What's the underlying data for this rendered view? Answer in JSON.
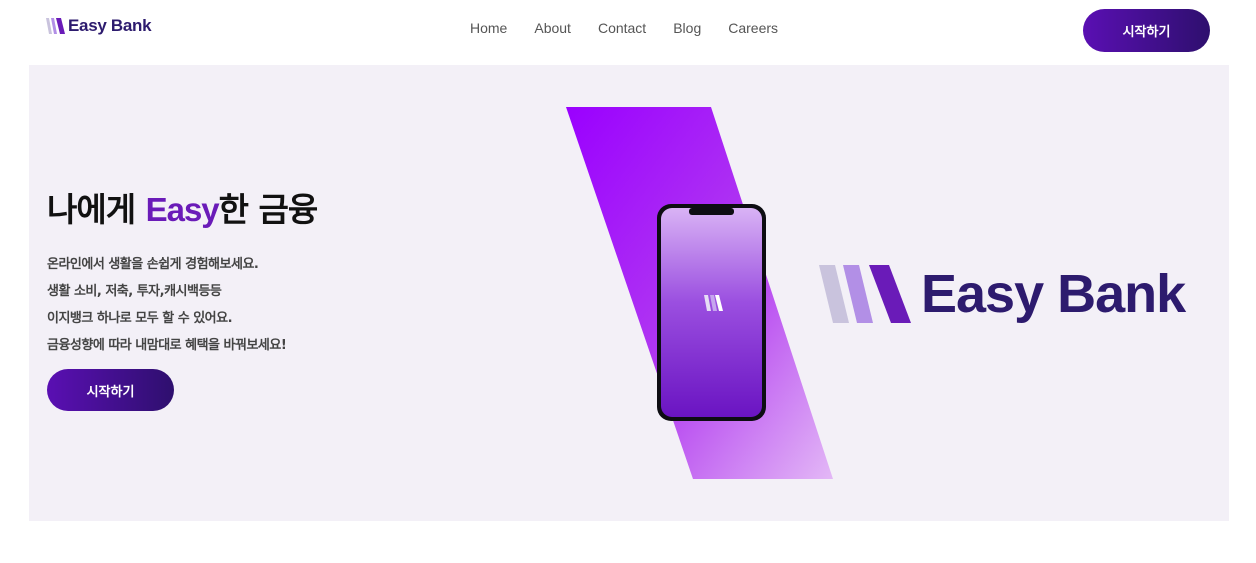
{
  "brand": {
    "name": "Easy Bank"
  },
  "nav": {
    "items": [
      {
        "label": "Home"
      },
      {
        "label": "About"
      },
      {
        "label": "Contact"
      },
      {
        "label": "Blog"
      },
      {
        "label": "Careers"
      }
    ],
    "cta_label": "시작하기"
  },
  "hero": {
    "title_prefix": "나에게 ",
    "title_accent": "Easy",
    "title_suffix": "한 금융",
    "lines": [
      "온라인에서 생활을 손쉽게 경험해보세요.",
      "생활 소비, 저축, 투자,캐시백등등",
      "이지뱅크 하나로 모두 할 수 있어요.",
      "금융성향에 따라 내맘대로 혜택을 바꿔보세요!"
    ],
    "cta_label": "시작하기",
    "brand_name": "Easy Bank"
  },
  "colors": {
    "brand_dark": "#2d1b6e",
    "accent": "#6a1bb8",
    "button_from": "#5a0fb3",
    "button_to": "#2e0f6e",
    "hero_bg": "#f3f0f7"
  },
  "icons": {
    "logo": "easy-bank-stripes-icon",
    "phone": "smartphone-illustration"
  }
}
